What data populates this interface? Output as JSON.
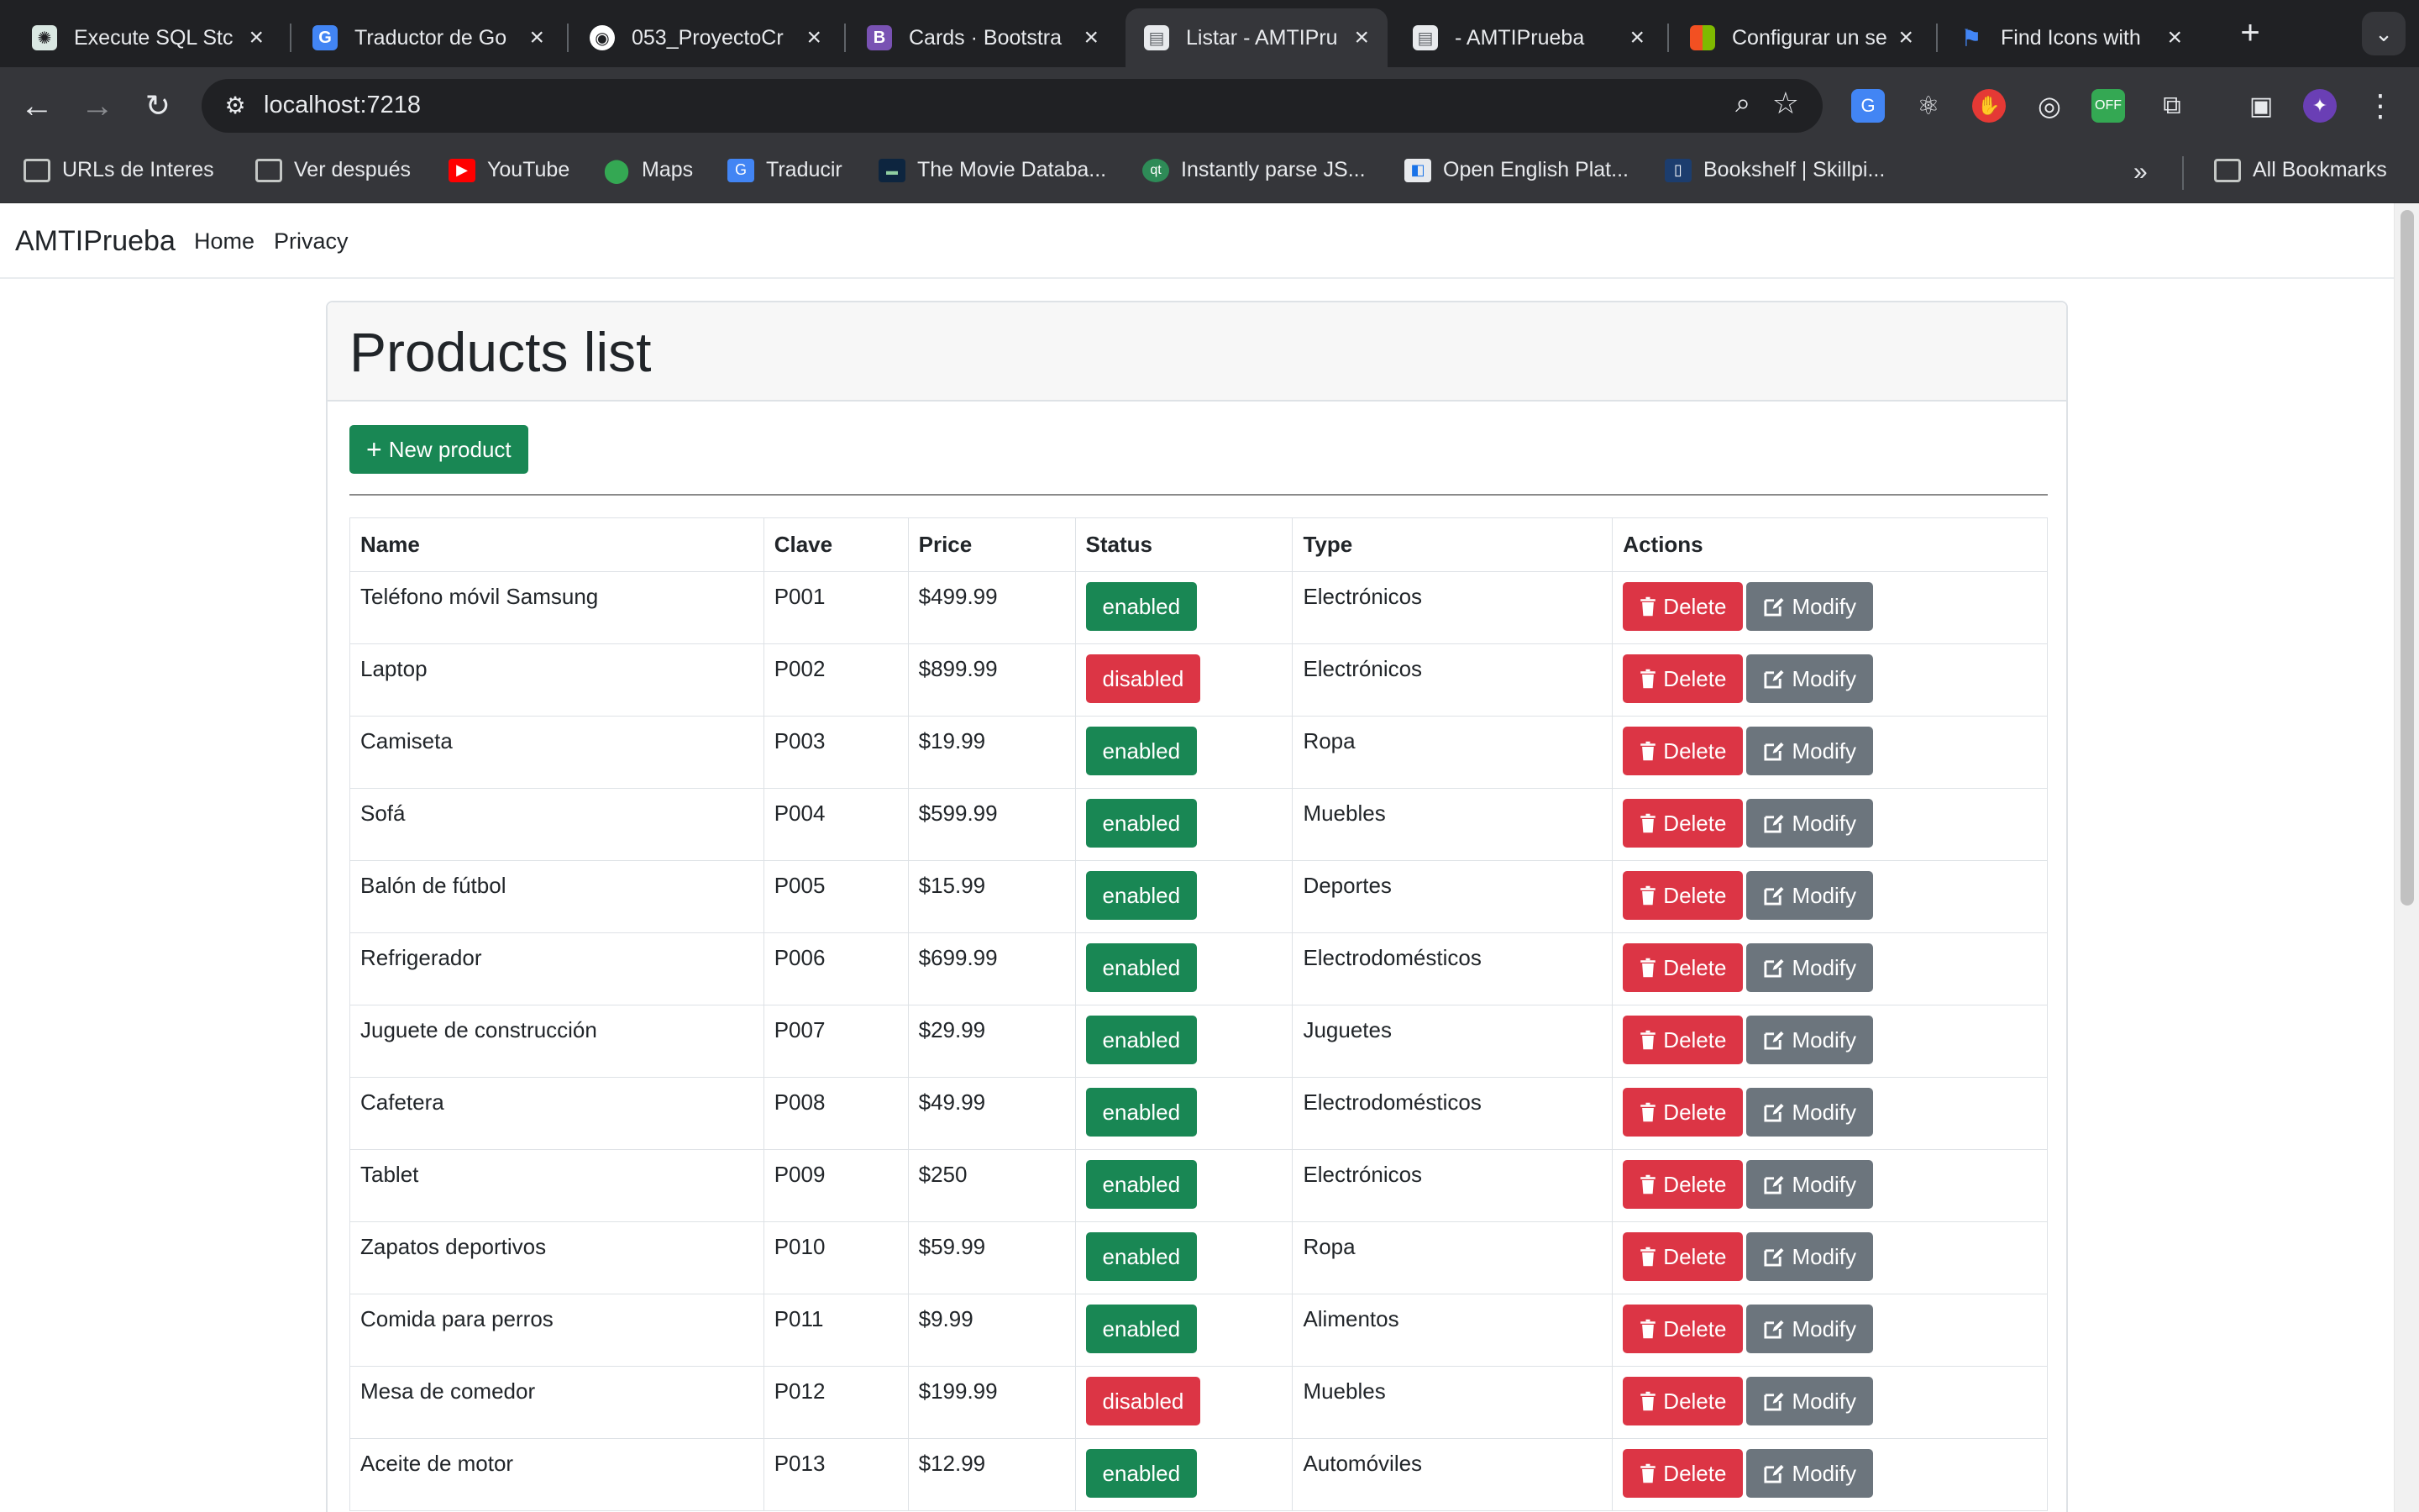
{
  "browser": {
    "tabs": [
      {
        "title": "Execute SQL Stc",
        "favicon": "chatgpt-icon",
        "active": false
      },
      {
        "title": "Traductor de Go",
        "favicon": "google-translate-icon",
        "active": false
      },
      {
        "title": "053_ProyectoCr",
        "favicon": "github-icon",
        "active": false
      },
      {
        "title": "Cards · Bootstra",
        "favicon": "bootstrap-icon",
        "active": false
      },
      {
        "title": "Listar - AMTIPru",
        "favicon": "document-icon",
        "active": true
      },
      {
        "title": "- AMTIPrueba",
        "favicon": "document-icon",
        "active": false
      },
      {
        "title": "Configurar un se",
        "favicon": "microsoft-icon",
        "active": false
      },
      {
        "title": "Find Icons with",
        "favicon": "flag-icon",
        "active": false
      }
    ],
    "url": "localhost:7218",
    "bookmarks": [
      {
        "label": "URLs de Interes",
        "icon": "folder-icon"
      },
      {
        "label": "Ver después",
        "icon": "folder-icon"
      },
      {
        "label": "YouTube",
        "icon": "youtube-icon"
      },
      {
        "label": "Maps",
        "icon": "maps-icon"
      },
      {
        "label": "Traducir",
        "icon": "google-translate-icon"
      },
      {
        "label": "The Movie Databa...",
        "icon": "tmdb-icon"
      },
      {
        "label": "Instantly parse JS...",
        "icon": "quicktype-icon"
      },
      {
        "label": "Open English Plat...",
        "icon": "open-english-icon"
      },
      {
        "label": "Bookshelf | Skillpi...",
        "icon": "skillpipe-icon"
      }
    ],
    "all_bookmarks": "All Bookmarks"
  },
  "app": {
    "brand": "AMTIPrueba",
    "nav": [
      "Home",
      "Privacy"
    ]
  },
  "page": {
    "title": "Products list",
    "new_button": "New product",
    "columns": [
      "Name",
      "Clave",
      "Price",
      "Status",
      "Type",
      "Actions"
    ],
    "delete_label": "Delete",
    "modify_label": "Modify",
    "rows": [
      {
        "name": "Teléfono móvil Samsung",
        "clave": "P001",
        "price": "$499.99",
        "status": "enabled",
        "type": "Electrónicos"
      },
      {
        "name": "Laptop",
        "clave": "P002",
        "price": "$899.99",
        "status": "disabled",
        "type": "Electrónicos"
      },
      {
        "name": "Camiseta",
        "clave": "P003",
        "price": "$19.99",
        "status": "enabled",
        "type": "Ropa"
      },
      {
        "name": "Sofá",
        "clave": "P004",
        "price": "$599.99",
        "status": "enabled",
        "type": "Muebles"
      },
      {
        "name": "Balón de fútbol",
        "clave": "P005",
        "price": "$15.99",
        "status": "enabled",
        "type": "Deportes"
      },
      {
        "name": "Refrigerador",
        "clave": "P006",
        "price": "$699.99",
        "status": "enabled",
        "type": "Electrodomésticos"
      },
      {
        "name": "Juguete de construcción",
        "clave": "P007",
        "price": "$29.99",
        "status": "enabled",
        "type": "Juguetes"
      },
      {
        "name": "Cafetera",
        "clave": "P008",
        "price": "$49.99",
        "status": "enabled",
        "type": "Electrodomésticos"
      },
      {
        "name": "Tablet",
        "clave": "P009",
        "price": "$250",
        "status": "enabled",
        "type": "Electrónicos"
      },
      {
        "name": "Zapatos deportivos",
        "clave": "P010",
        "price": "$59.99",
        "status": "enabled",
        "type": "Ropa"
      },
      {
        "name": "Comida para perros",
        "clave": "P011",
        "price": "$9.99",
        "status": "enabled",
        "type": "Alimentos"
      },
      {
        "name": "Mesa de comedor",
        "clave": "P012",
        "price": "$199.99",
        "status": "disabled",
        "type": "Muebles"
      },
      {
        "name": "Aceite de motor",
        "clave": "P013",
        "price": "$12.99",
        "status": "enabled",
        "type": "Automóviles"
      }
    ]
  },
  "colors": {
    "success": "#198754",
    "danger": "#dc3545",
    "secondary": "#6c757d"
  }
}
